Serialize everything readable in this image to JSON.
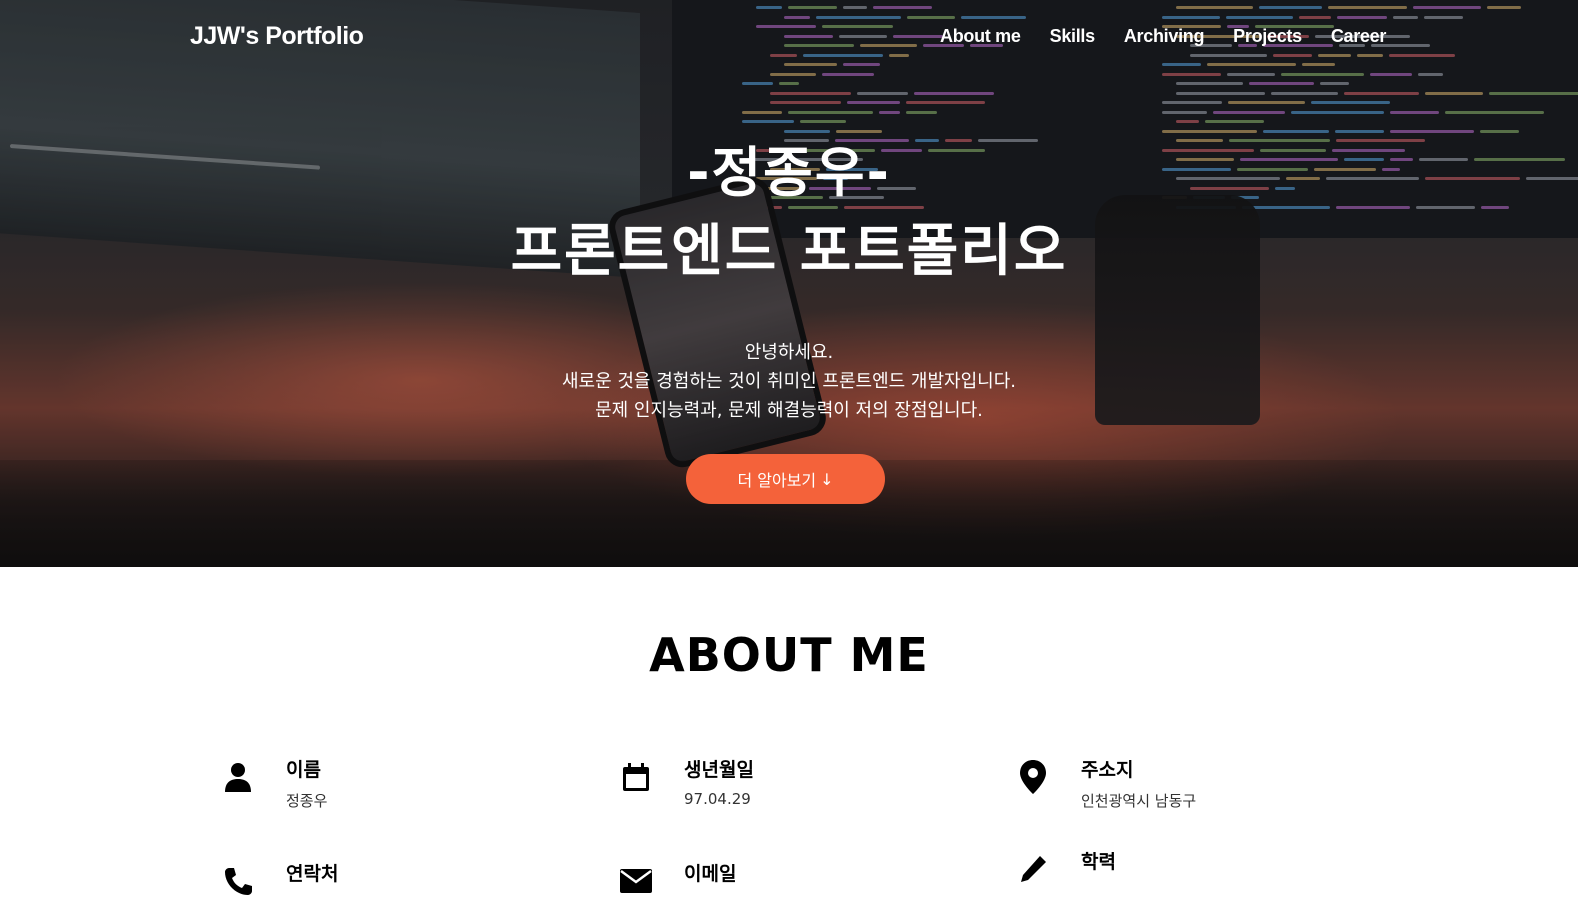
{
  "nav": {
    "brand": "JJW's Portfolio",
    "links": [
      "About me",
      "Skills",
      "Archiving",
      "Projects",
      "Career"
    ]
  },
  "hero": {
    "title_line1": "-정종우-",
    "title_line2": "프론트엔드 포트폴리오",
    "intro": [
      "안녕하세요.",
      "새로운 것을 경험하는 것이 취미인 프론트엔드 개발자입니다.",
      "문제 인지능력과, 문제 해결능력이 저의 장점입니다."
    ],
    "cta_label": "더 알아보기",
    "cta_arrow": "↓",
    "accent_color": "#f4623a"
  },
  "about": {
    "title": "ABOUT ME",
    "items": [
      {
        "icon": "person-icon",
        "label": "이름",
        "value": "정종우"
      },
      {
        "icon": "calendar-icon",
        "label": "생년월일",
        "value": "97.04.29"
      },
      {
        "icon": "location-pin-icon",
        "label": "주소지",
        "value": "인천광역시 남동구"
      },
      {
        "icon": "phone-icon",
        "label": "연락처",
        "value": ""
      },
      {
        "icon": "mail-icon",
        "label": "이메일",
        "value": ""
      },
      {
        "icon": "pencil-icon",
        "label": "학력",
        "value": ""
      }
    ]
  }
}
